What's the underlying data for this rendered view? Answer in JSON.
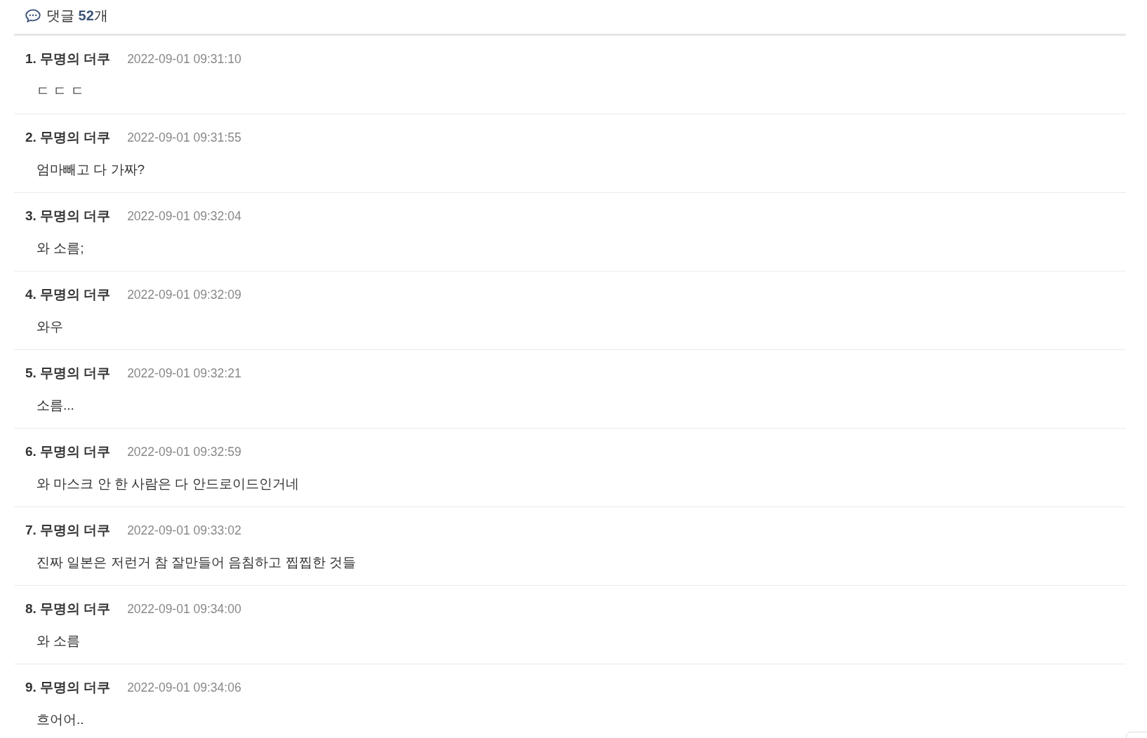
{
  "comments_header": {
    "text": "댓글 **52**개"
  },
  "comments": [
    {
      "number": "1.",
      "author": "무명의 더쿠",
      "time": "2022-09-01 09:31:10",
      "text": "ㄷ ㄷ ㄷ"
    },
    {
      "number": "2.",
      "author": "무명의 더쿠",
      "time": "2022-09-01 09:31:55",
      "text": "엄마빼고 다 가짜?"
    },
    {
      "number": "3.",
      "author": "무명의 더쿠",
      "time": "2022-09-01 09:32:04",
      "text": "와 소름;"
    },
    {
      "number": "4.",
      "author": "무명의 더쿠",
      "time": "2022-09-01 09:32:09",
      "text": "와우"
    },
    {
      "number": "5.",
      "author": "무명의 더쿠",
      "time": "2022-09-01 09:32:21",
      "text": "소름..."
    },
    {
      "number": "6.",
      "author": "무명의 더쿠",
      "time": "2022-09-01 09:32:59",
      "text": "와 마스크 안 한 사람은 다 안드로이드인거네"
    },
    {
      "number": "7.",
      "author": "무명의 더쿠",
      "time": "2022-09-01 09:33:02",
      "text": "진짜 일본은 저런거 참 잘만들어 음침하고 찝찝한 것들"
    },
    {
      "number": "8.",
      "author": "무명의 더쿠",
      "time": "2022-09-01 09:34:00",
      "text": "와 소름"
    },
    {
      "number": "9.",
      "author": "무명의 더쿠",
      "time": "2022-09-01 09:34:06",
      "text": "흐어어.."
    }
  ]
}
